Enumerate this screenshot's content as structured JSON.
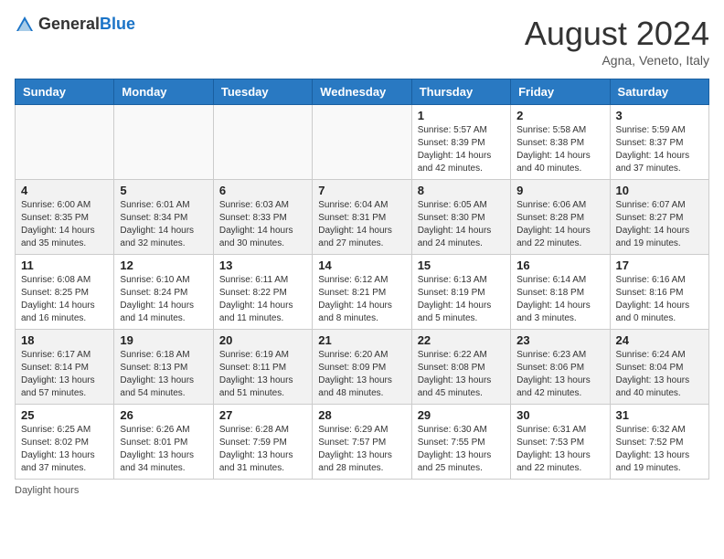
{
  "header": {
    "logo_general": "General",
    "logo_blue": "Blue",
    "month_year": "August 2024",
    "location": "Agna, Veneto, Italy"
  },
  "days_of_week": [
    "Sunday",
    "Monday",
    "Tuesday",
    "Wednesday",
    "Thursday",
    "Friday",
    "Saturday"
  ],
  "weeks": [
    [
      {
        "day": "",
        "info": ""
      },
      {
        "day": "",
        "info": ""
      },
      {
        "day": "",
        "info": ""
      },
      {
        "day": "",
        "info": ""
      },
      {
        "day": "1",
        "info": "Sunrise: 5:57 AM\nSunset: 8:39 PM\nDaylight: 14 hours and 42 minutes."
      },
      {
        "day": "2",
        "info": "Sunrise: 5:58 AM\nSunset: 8:38 PM\nDaylight: 14 hours and 40 minutes."
      },
      {
        "day": "3",
        "info": "Sunrise: 5:59 AM\nSunset: 8:37 PM\nDaylight: 14 hours and 37 minutes."
      }
    ],
    [
      {
        "day": "4",
        "info": "Sunrise: 6:00 AM\nSunset: 8:35 PM\nDaylight: 14 hours and 35 minutes."
      },
      {
        "day": "5",
        "info": "Sunrise: 6:01 AM\nSunset: 8:34 PM\nDaylight: 14 hours and 32 minutes."
      },
      {
        "day": "6",
        "info": "Sunrise: 6:03 AM\nSunset: 8:33 PM\nDaylight: 14 hours and 30 minutes."
      },
      {
        "day": "7",
        "info": "Sunrise: 6:04 AM\nSunset: 8:31 PM\nDaylight: 14 hours and 27 minutes."
      },
      {
        "day": "8",
        "info": "Sunrise: 6:05 AM\nSunset: 8:30 PM\nDaylight: 14 hours and 24 minutes."
      },
      {
        "day": "9",
        "info": "Sunrise: 6:06 AM\nSunset: 8:28 PM\nDaylight: 14 hours and 22 minutes."
      },
      {
        "day": "10",
        "info": "Sunrise: 6:07 AM\nSunset: 8:27 PM\nDaylight: 14 hours and 19 minutes."
      }
    ],
    [
      {
        "day": "11",
        "info": "Sunrise: 6:08 AM\nSunset: 8:25 PM\nDaylight: 14 hours and 16 minutes."
      },
      {
        "day": "12",
        "info": "Sunrise: 6:10 AM\nSunset: 8:24 PM\nDaylight: 14 hours and 14 minutes."
      },
      {
        "day": "13",
        "info": "Sunrise: 6:11 AM\nSunset: 8:22 PM\nDaylight: 14 hours and 11 minutes."
      },
      {
        "day": "14",
        "info": "Sunrise: 6:12 AM\nSunset: 8:21 PM\nDaylight: 14 hours and 8 minutes."
      },
      {
        "day": "15",
        "info": "Sunrise: 6:13 AM\nSunset: 8:19 PM\nDaylight: 14 hours and 5 minutes."
      },
      {
        "day": "16",
        "info": "Sunrise: 6:14 AM\nSunset: 8:18 PM\nDaylight: 14 hours and 3 minutes."
      },
      {
        "day": "17",
        "info": "Sunrise: 6:16 AM\nSunset: 8:16 PM\nDaylight: 14 hours and 0 minutes."
      }
    ],
    [
      {
        "day": "18",
        "info": "Sunrise: 6:17 AM\nSunset: 8:14 PM\nDaylight: 13 hours and 57 minutes."
      },
      {
        "day": "19",
        "info": "Sunrise: 6:18 AM\nSunset: 8:13 PM\nDaylight: 13 hours and 54 minutes."
      },
      {
        "day": "20",
        "info": "Sunrise: 6:19 AM\nSunset: 8:11 PM\nDaylight: 13 hours and 51 minutes."
      },
      {
        "day": "21",
        "info": "Sunrise: 6:20 AM\nSunset: 8:09 PM\nDaylight: 13 hours and 48 minutes."
      },
      {
        "day": "22",
        "info": "Sunrise: 6:22 AM\nSunset: 8:08 PM\nDaylight: 13 hours and 45 minutes."
      },
      {
        "day": "23",
        "info": "Sunrise: 6:23 AM\nSunset: 8:06 PM\nDaylight: 13 hours and 42 minutes."
      },
      {
        "day": "24",
        "info": "Sunrise: 6:24 AM\nSunset: 8:04 PM\nDaylight: 13 hours and 40 minutes."
      }
    ],
    [
      {
        "day": "25",
        "info": "Sunrise: 6:25 AM\nSunset: 8:02 PM\nDaylight: 13 hours and 37 minutes."
      },
      {
        "day": "26",
        "info": "Sunrise: 6:26 AM\nSunset: 8:01 PM\nDaylight: 13 hours and 34 minutes."
      },
      {
        "day": "27",
        "info": "Sunrise: 6:28 AM\nSunset: 7:59 PM\nDaylight: 13 hours and 31 minutes."
      },
      {
        "day": "28",
        "info": "Sunrise: 6:29 AM\nSunset: 7:57 PM\nDaylight: 13 hours and 28 minutes."
      },
      {
        "day": "29",
        "info": "Sunrise: 6:30 AM\nSunset: 7:55 PM\nDaylight: 13 hours and 25 minutes."
      },
      {
        "day": "30",
        "info": "Sunrise: 6:31 AM\nSunset: 7:53 PM\nDaylight: 13 hours and 22 minutes."
      },
      {
        "day": "31",
        "info": "Sunrise: 6:32 AM\nSunset: 7:52 PM\nDaylight: 13 hours and 19 minutes."
      }
    ]
  ],
  "footer": {
    "daylight_hours_label": "Daylight hours"
  }
}
